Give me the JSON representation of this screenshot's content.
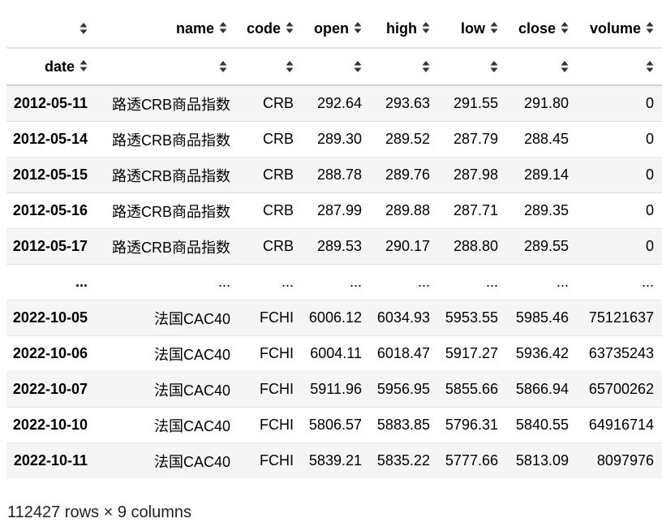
{
  "table": {
    "columns": [
      "name",
      "code",
      "open",
      "high",
      "low",
      "close",
      "volume"
    ],
    "index_name": "date",
    "rows": [
      {
        "date": "2012-05-11",
        "name": "路透CRB商品指数",
        "code": "CRB",
        "open": "292.64",
        "high": "293.63",
        "low": "291.55",
        "close": "291.80",
        "volume": "0"
      },
      {
        "date": "2012-05-14",
        "name": "路透CRB商品指数",
        "code": "CRB",
        "open": "289.30",
        "high": "289.52",
        "low": "287.79",
        "close": "288.45",
        "volume": "0"
      },
      {
        "date": "2012-05-15",
        "name": "路透CRB商品指数",
        "code": "CRB",
        "open": "288.78",
        "high": "289.76",
        "low": "287.98",
        "close": "289.14",
        "volume": "0"
      },
      {
        "date": "2012-05-16",
        "name": "路透CRB商品指数",
        "code": "CRB",
        "open": "287.99",
        "high": "289.88",
        "low": "287.71",
        "close": "289.35",
        "volume": "0"
      },
      {
        "date": "2012-05-17",
        "name": "路透CRB商品指数",
        "code": "CRB",
        "open": "289.53",
        "high": "290.17",
        "low": "288.80",
        "close": "289.55",
        "volume": "0"
      },
      {
        "date": "...",
        "name": "...",
        "code": "...",
        "open": "...",
        "high": "...",
        "low": "...",
        "close": "...",
        "volume": "..."
      },
      {
        "date": "2022-10-05",
        "name": "法国CAC40",
        "code": "FCHI",
        "open": "6006.12",
        "high": "6034.93",
        "low": "5953.55",
        "close": "5985.46",
        "volume": "75121637"
      },
      {
        "date": "2022-10-06",
        "name": "法国CAC40",
        "code": "FCHI",
        "open": "6004.11",
        "high": "6018.47",
        "low": "5917.27",
        "close": "5936.42",
        "volume": "63735243"
      },
      {
        "date": "2022-10-07",
        "name": "法国CAC40",
        "code": "FCHI",
        "open": "5911.96",
        "high": "5956.95",
        "low": "5855.66",
        "close": "5866.94",
        "volume": "65700262"
      },
      {
        "date": "2022-10-10",
        "name": "法国CAC40",
        "code": "FCHI",
        "open": "5806.57",
        "high": "5883.85",
        "low": "5796.31",
        "close": "5840.55",
        "volume": "64916714"
      },
      {
        "date": "2022-10-11",
        "name": "法国CAC40",
        "code": "FCHI",
        "open": "5839.21",
        "high": "5835.22",
        "low": "5777.66",
        "close": "5813.09",
        "volume": "8097976"
      }
    ]
  },
  "footer": "112427 rows × 9 columns",
  "icons": {
    "sort": "sort-icon"
  },
  "colors": {
    "row_stripe": "#f5f5f5",
    "border": "#e4e4e4",
    "sort_icon": "#333333"
  }
}
